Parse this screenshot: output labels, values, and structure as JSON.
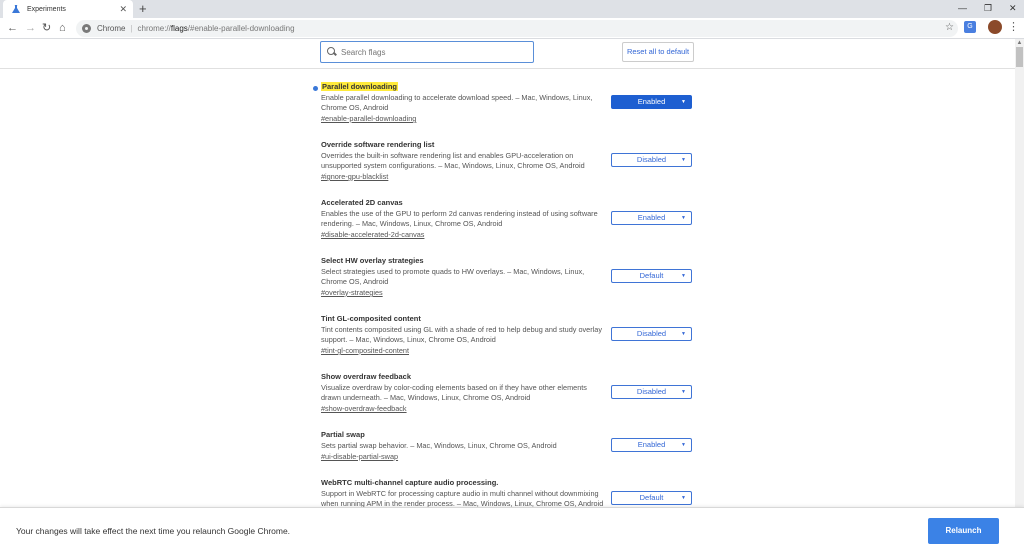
{
  "tab": {
    "title": "Experiments",
    "icon": "flask-icon"
  },
  "omnibox": {
    "site_label": "Chrome",
    "url_prefix": "chrome://",
    "url_host": "flags",
    "url_path": "/#enable-parallel-downloading"
  },
  "search": {
    "placeholder": "Search flags"
  },
  "reset_label": "Reset all to default",
  "flags": [
    {
      "title": "Parallel downloading",
      "description": "Enable parallel downloading to accelerate download speed. – Mac, Windows, Linux, Chrome OS, Android",
      "link": "#enable-parallel-downloading",
      "value": "Enabled",
      "highlighted": true
    },
    {
      "title": "Override software rendering list",
      "description": "Overrides the built-in software rendering list and enables GPU-acceleration on unsupported system configurations. – Mac, Windows, Linux, Chrome OS, Android",
      "link": "#ignore-gpu-blacklist",
      "value": "Disabled",
      "highlighted": false
    },
    {
      "title": "Accelerated 2D canvas",
      "description": "Enables the use of the GPU to perform 2d canvas rendering instead of using software rendering. – Mac, Windows, Linux, Chrome OS, Android",
      "link": "#disable-accelerated-2d-canvas",
      "value": "Enabled",
      "highlighted": false
    },
    {
      "title": "Select HW overlay strategies",
      "description": "Select strategies used to promote quads to HW overlays. – Mac, Windows, Linux, Chrome OS, Android",
      "link": "#overlay-strategies",
      "value": "Default",
      "highlighted": false
    },
    {
      "title": "Tint GL-composited content",
      "description": "Tint contents composited using GL with a shade of red to help debug and study overlay support. – Mac, Windows, Linux, Chrome OS, Android",
      "link": "#tint-gl-composited-content",
      "value": "Disabled",
      "highlighted": false
    },
    {
      "title": "Show overdraw feedback",
      "description": "Visualize overdraw by color-coding elements based on if they have other elements drawn underneath. – Mac, Windows, Linux, Chrome OS, Android",
      "link": "#show-overdraw-feedback",
      "value": "Disabled",
      "highlighted": false
    },
    {
      "title": "Partial swap",
      "description": "Sets partial swap behavior. – Mac, Windows, Linux, Chrome OS, Android",
      "link": "#ui-disable-partial-swap",
      "value": "Enabled",
      "highlighted": false
    },
    {
      "title": "WebRTC multi-channel capture audio processing.",
      "description": "Support in WebRTC for processing capture audio in multi channel without downmixing when running APM in the render process. – Mac, Windows, Linux, Chrome OS, Android",
      "link": "",
      "value": "Default",
      "highlighted": false
    }
  ],
  "relaunch": {
    "message": "Your changes will take effect the next time you relaunch Google Chrome.",
    "button": "Relaunch"
  },
  "colors": {
    "accent": "#3b82e6",
    "highlight": "#ffeb3b",
    "enabled_bg": "#1e5fd1"
  }
}
